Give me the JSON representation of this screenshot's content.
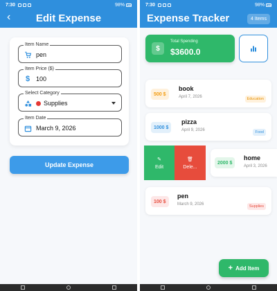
{
  "left_phone": {
    "status": {
      "time": "7:30",
      "battery": "98%"
    },
    "title": "Edit Expense",
    "fields": [
      {
        "label": "Item Name",
        "value": "pen",
        "icon": "cart-icon"
      },
      {
        "label": "Item Price ($)",
        "value": "100",
        "icon": "dollar-icon"
      },
      {
        "label": "Select Category",
        "value": "Supplies",
        "icon": "category-icon"
      },
      {
        "label": "Item Date",
        "value": "March 9, 2026",
        "icon": "calendar-icon"
      }
    ],
    "update_label": "Update Expense"
  },
  "right_phone": {
    "status": {
      "time": "7:30",
      "battery": "98%"
    },
    "title": "Expense Tracker",
    "items_badge": "4 Items",
    "total": {
      "label": "Total Spending",
      "value": "$3600.0"
    },
    "expenses": [
      {
        "name": "book",
        "amount": "500 $",
        "date": "April 7, 2026",
        "category": "Education"
      },
      {
        "name": "pizza",
        "amount": "1000 $",
        "date": "April 9, 2026",
        "category": "Food"
      },
      {
        "name": "home",
        "amount": "2000 $",
        "date": "April 3, 2026",
        "category": ""
      },
      {
        "name": "pen",
        "amount": "100 $",
        "date": "March 9, 2026",
        "category": "Supplies"
      }
    ],
    "swipe_actions": {
      "edit": "Edit",
      "delete": "Dele..."
    },
    "add_label": "Add Item"
  },
  "colors": {
    "appbar": "#2f8fdd",
    "green": "#2fb86a",
    "red": "#e74c3c",
    "update_button": "#3d9be9"
  }
}
